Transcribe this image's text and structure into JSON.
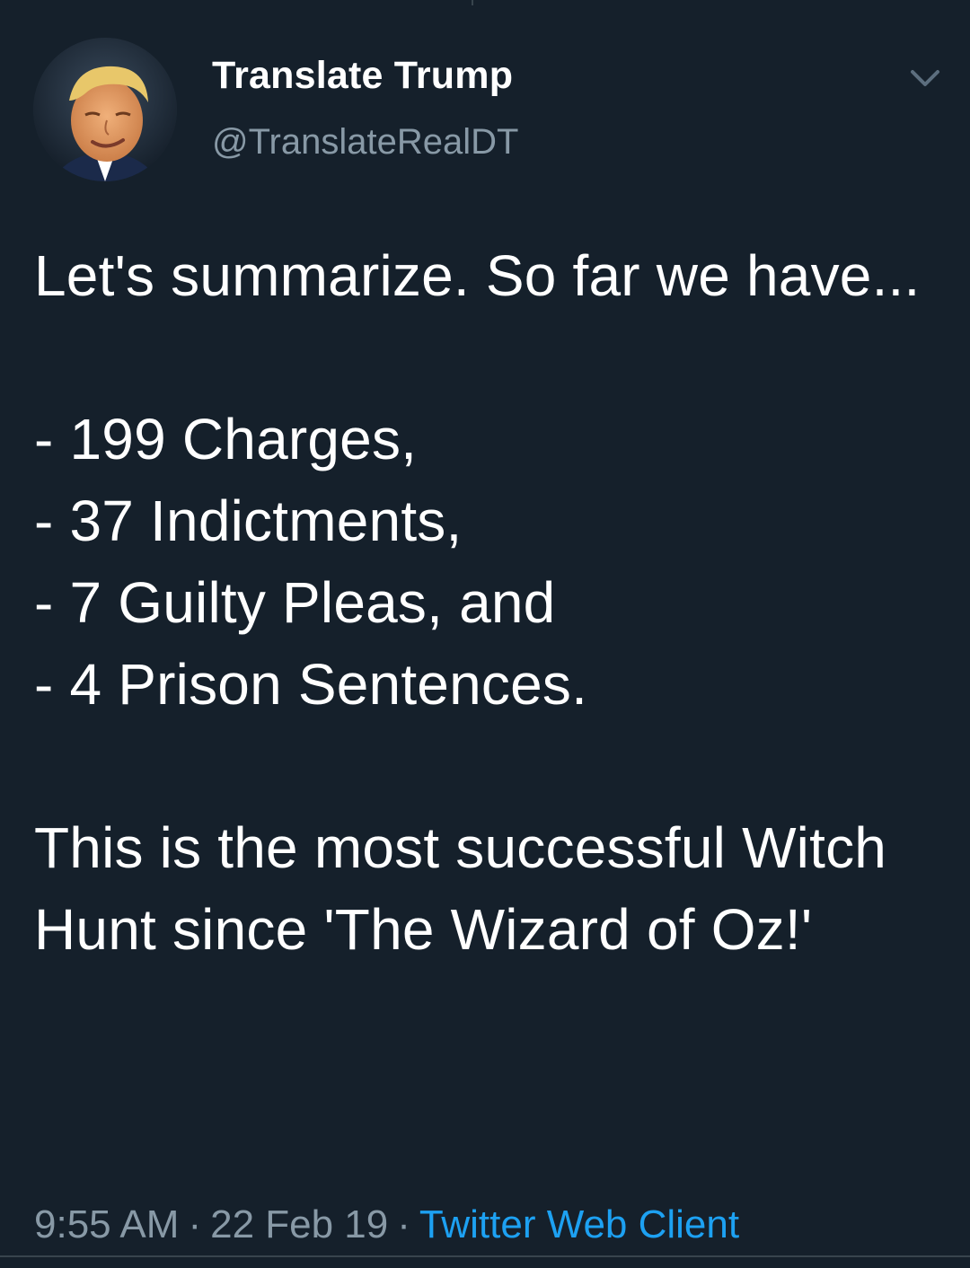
{
  "user": {
    "display_name": "Translate Trump",
    "handle": "@TranslateRealDT",
    "avatar_icon": "profile-photo"
  },
  "tweet": {
    "text": "Let's summarize. So far we have...\n\n- 199 Charges,\n- 37 Indictments,\n- 7 Guilty Pleas, and\n- 4 Prison Sentences.\n\nThis is the most successful Witch Hunt since 'The Wizard of Oz!'",
    "time": "9:55 AM",
    "date": "22 Feb 19",
    "source": "Twitter Web Client",
    "separator": "·"
  },
  "icons": {
    "more": "chevron-down-icon"
  },
  "colors": {
    "background": "#15202b",
    "text_primary": "#ffffff",
    "text_secondary": "#8899a6",
    "link": "#1da1f2"
  }
}
